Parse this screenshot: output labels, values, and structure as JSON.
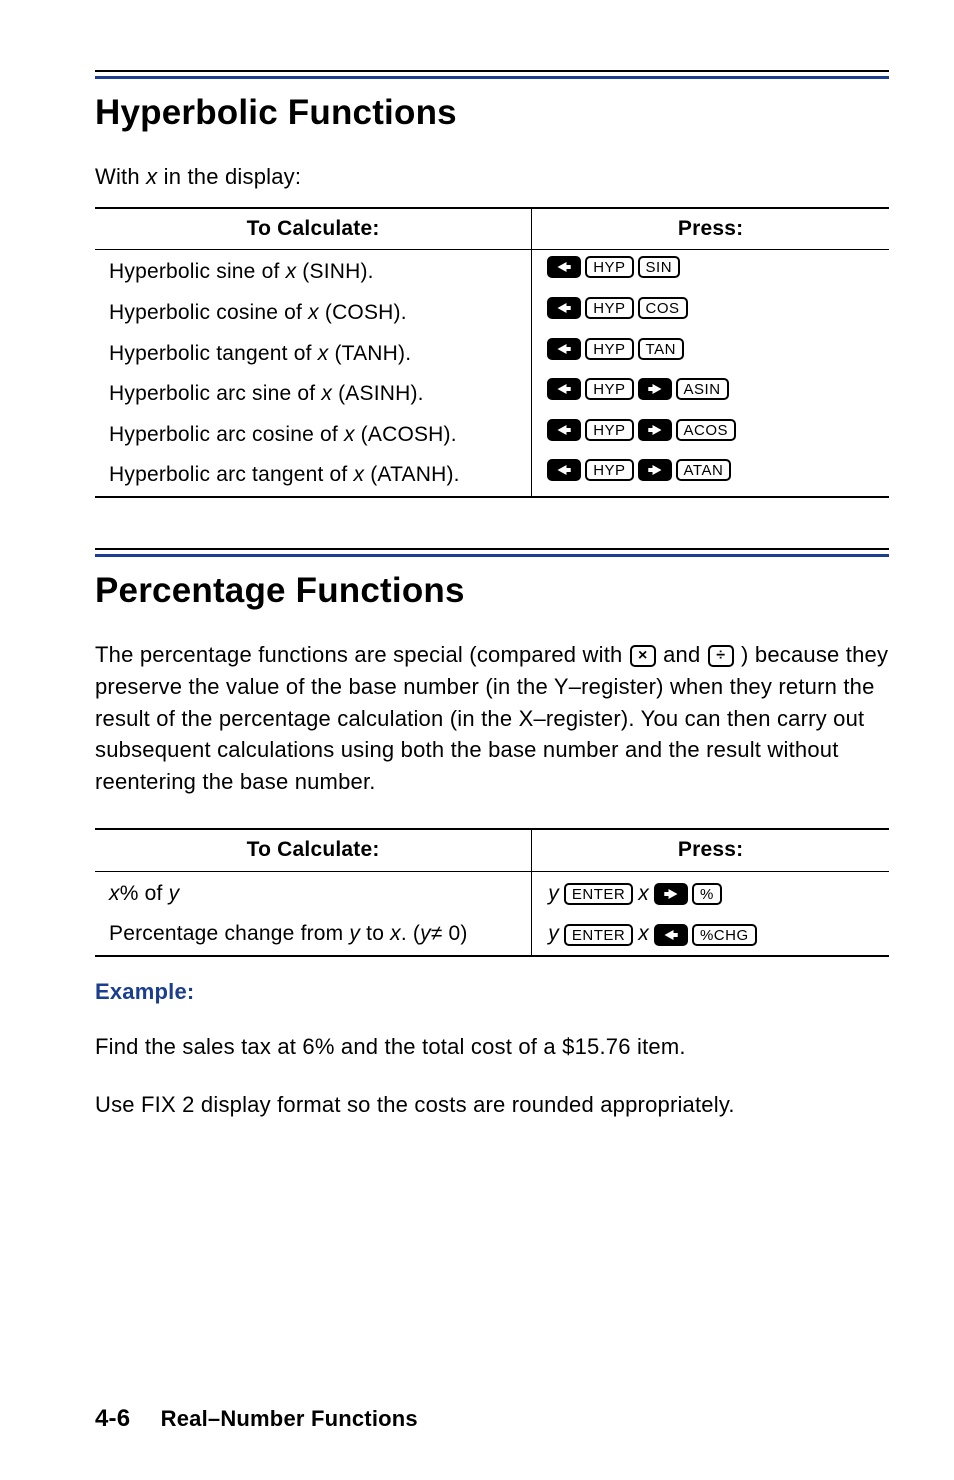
{
  "section1_title": "Hyperbolic Functions",
  "section1_lead_pre": "With ",
  "section1_lead_var": "x",
  "section1_lead_post": " in the display:",
  "th_calc": "To Calculate:",
  "th_press": "Press:",
  "hyp_rows": [
    {
      "label_pre": "Hyperbolic sine of ",
      "var": "x",
      "label_post": " (SINH).",
      "keys": [
        "SL",
        "HYP",
        "SIN"
      ]
    },
    {
      "label_pre": "Hyperbolic cosine of ",
      "var": "x",
      "label_post": " (COSH).",
      "keys": [
        "SL",
        "HYP",
        "COS"
      ]
    },
    {
      "label_pre": "Hyperbolic tangent of ",
      "var": "x",
      "label_post": " (TANH).",
      "keys": [
        "SL",
        "HYP",
        "TAN"
      ]
    },
    {
      "label_pre": "Hyperbolic arc sine of ",
      "var": "x",
      "label_post": " (ASINH).",
      "keys": [
        "SL",
        "HYP",
        "SR",
        "ASIN"
      ]
    },
    {
      "label_pre": "Hyperbolic arc cosine of ",
      "var": "x",
      "label_post": " (ACOSH).",
      "keys": [
        "SL",
        "HYP",
        "SR",
        "ACOS"
      ]
    },
    {
      "label_pre": "Hyperbolic arc tangent of ",
      "var": "x",
      "label_post": " (ATANH).",
      "keys": [
        "SL",
        "HYP",
        "SR",
        "ATAN"
      ]
    }
  ],
  "section2_title": "Percentage Functions",
  "section2_para_a": "The percentage functions are special (compared with ",
  "section2_para_b": " and ",
  "section2_para_c": " ) because they preserve the value of the base number (in the Y–register) when they return the result of the percentage calculation (in the X–register). You can then carry out subsequent calculations using both the base number and the result without reentering the base number.",
  "op_mult": "×",
  "op_div": "÷",
  "pct_rows": [
    {
      "left_html": "<span class='ital'>x</span>% of <span class='ital'>y</span>",
      "seq": [
        "vy",
        "ENTER",
        "vx",
        "SR",
        "%"
      ]
    },
    {
      "left_html": "Percentage change from <span class='ital'>y</span> to <span class='ital'>x</span>. (<span class='ital'>y</span>≠ 0)",
      "seq": [
        "vy",
        "ENTER",
        "vx",
        "SL",
        "%CHG"
      ]
    }
  ],
  "example_label": "Example:",
  "example_line1": "Find the sales tax at 6% and the total cost of a $15.76 item.",
  "example_line2": "Use FIX 2 display format so the costs are rounded appropriately.",
  "footer_page": "4-6",
  "footer_chapter": "Real–Number Functions"
}
